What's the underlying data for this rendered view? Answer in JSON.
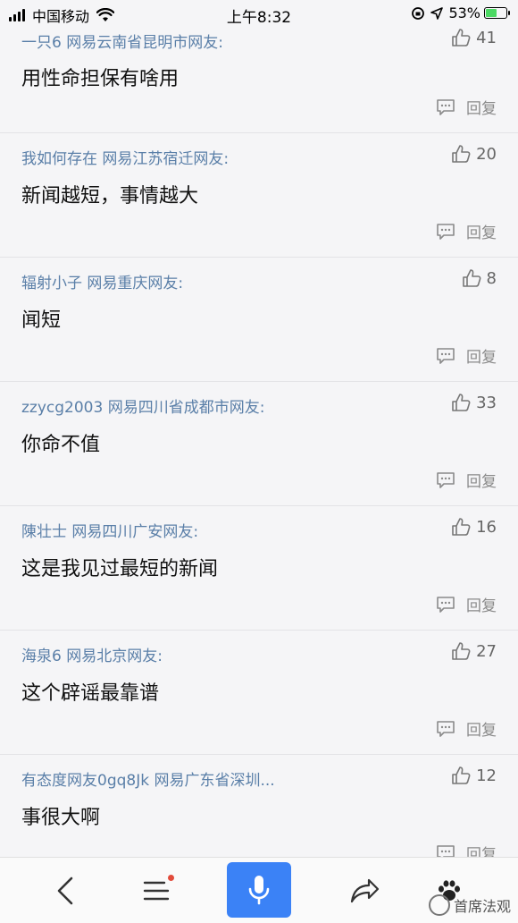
{
  "status_bar": {
    "carrier": "中国移动",
    "time": "上午8:32",
    "battery": "53%",
    "battery_level": 0.53
  },
  "comments": [
    {
      "user": "一只6  网易云南省昆明市网友:",
      "likes": "41",
      "text": "用性命担保有啥用",
      "reply": "回复"
    },
    {
      "user": "我如何存在  网易江苏宿迁网友:",
      "likes": "20",
      "text": "新闻越短，事情越大",
      "reply": "回复"
    },
    {
      "user": "辐射小子  网易重庆网友:",
      "likes": "8",
      "text": "闻短",
      "reply": "回复"
    },
    {
      "user": "zzycg2003  网易四川省成都市网友:",
      "likes": "33",
      "text": "你命不值",
      "reply": "回复"
    },
    {
      "user": "陳壮士  网易四川广安网友:",
      "likes": "16",
      "text": "这是我见过最短的新闻",
      "reply": "回复"
    },
    {
      "user": "海泉6  网易北京网友:",
      "likes": "27",
      "text": "这个辟谣最靠谱",
      "reply": "回复"
    },
    {
      "user": "有态度网友0gq8Jk  网易广东省深圳...",
      "likes": "12",
      "text": "事很大啊",
      "reply": "回复"
    }
  ],
  "toolbar": {
    "icons": [
      "back-icon",
      "menu-icon",
      "microphone-icon",
      "share-icon",
      "paw-icon"
    ]
  },
  "watermark": "首席法观"
}
